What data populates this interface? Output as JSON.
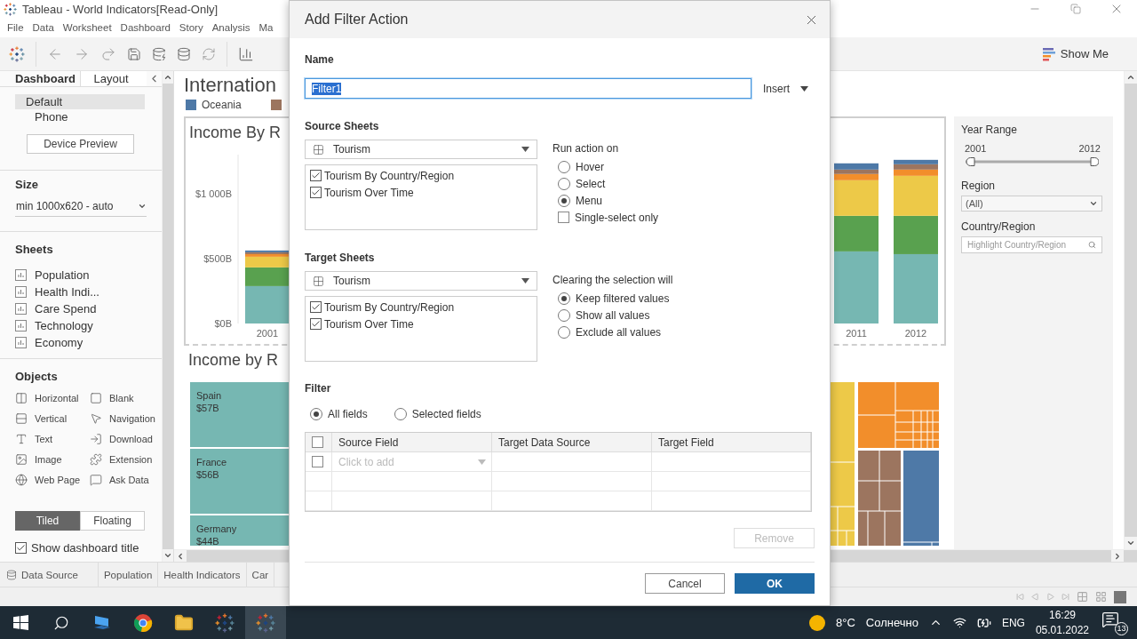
{
  "window": {
    "title": "Tableau - World Indicators[Read-Only]"
  },
  "menu": [
    "File",
    "Data",
    "Worksheet",
    "Dashboard",
    "Story",
    "Analysis",
    "Ma"
  ],
  "toolbar": {
    "show_me": "Show Me"
  },
  "left_panel": {
    "tabs": [
      {
        "label": "Dashboard",
        "selected": true
      },
      {
        "label": "Layout",
        "selected": false
      }
    ],
    "devices": [
      {
        "label": "Default",
        "selected": true,
        "children": [
          {
            "label": "Phone",
            "selected": false
          }
        ]
      }
    ],
    "device_preview": "Device Preview",
    "size": {
      "heading": "Size",
      "value": "min 1000x620 - auto"
    },
    "sheets": {
      "heading": "Sheets",
      "items": [
        "Population",
        "Health Indi...",
        "Care Spend",
        "Technology",
        "Economy"
      ]
    },
    "objects": {
      "heading": "Objects",
      "items": [
        {
          "kind": "horizontal",
          "label": "Horizontal"
        },
        {
          "kind": "blank",
          "label": "Blank"
        },
        {
          "kind": "vertical",
          "label": "Vertical"
        },
        {
          "kind": "navigation",
          "label": "Navigation"
        },
        {
          "kind": "text",
          "label": "Text"
        },
        {
          "kind": "download",
          "label": "Download"
        },
        {
          "kind": "image",
          "label": "Image"
        },
        {
          "kind": "extension",
          "label": "Extension"
        },
        {
          "kind": "webpage",
          "label": "Web Page"
        },
        {
          "kind": "askdata",
          "label": "Ask Data"
        }
      ]
    },
    "layout_mode": [
      {
        "label": "Tiled",
        "selected": true
      },
      {
        "label": "Floating",
        "selected": false
      }
    ],
    "show_title": {
      "label": "Show dashboard title",
      "checked": true
    }
  },
  "dashboard": {
    "title": "Internation",
    "bar_chart": {
      "title": "Income By R",
      "chart_data": {
        "type": "bar",
        "stacked": true,
        "categories": [
          "2001",
          "2011",
          "2012"
        ],
        "ylim": [
          0,
          1300
        ],
        "yticks": [
          {
            "value": 0,
            "label": "$0B"
          },
          {
            "value": 500,
            "label": "$500B"
          },
          {
            "value": 1000,
            "label": "$1 000B"
          }
        ],
        "series": [
          {
            "color": "#76b7b2",
            "values": [
              288,
              555,
              534
            ]
          },
          {
            "color": "#59a14f",
            "values": [
              144,
              274,
              295
            ]
          },
          {
            "color": "#edc948",
            "values": [
              82,
              274,
              308
            ]
          },
          {
            "color": "#f28e2b",
            "values": [
              20,
              48,
              48
            ]
          },
          {
            "color": "#9c755f",
            "values": [
              14,
              34,
              41
            ]
          },
          {
            "name": "Oceania",
            "color": "#4e79a7",
            "values": [
              14,
              48,
              34
            ]
          }
        ]
      }
    },
    "treemap": {
      "title": "Income by R",
      "tiles": [
        {
          "label": "Spain",
          "value": "$57B"
        },
        {
          "label": "France",
          "value": "$56B"
        },
        {
          "label": "Germany",
          "value": "$44B"
        }
      ]
    },
    "filters": {
      "year_range": {
        "label": "Year Range",
        "from": "2001",
        "to": "2012",
        "level": 1
      },
      "region": {
        "label": "Region",
        "value": "(All)"
      },
      "country": {
        "label": "Country/Region",
        "placeholder": "Highlight Country/Region"
      }
    }
  },
  "sheet_tabs": [
    {
      "label": "Data Source",
      "kind": "datasource"
    },
    {
      "label": "Population",
      "kind": "sheet"
    },
    {
      "label": "Health Indicators",
      "kind": "sheet"
    },
    {
      "label": "Car",
      "kind": "sheet"
    }
  ],
  "taskbar": {
    "temperature": "8°C",
    "weather": "Солнечно",
    "language": "ENG",
    "time": "16:29",
    "date": "05.01.2022",
    "notifications": "13"
  },
  "dialog": {
    "title": "Add Filter Action",
    "name_label": "Name",
    "name_value": "Filter1",
    "name_selected": true,
    "insert": "Insert",
    "source": {
      "heading": "Source Sheets",
      "dropdown": "Tourism",
      "sheets": [
        {
          "label": "Tourism By Country/Region",
          "checked": true
        },
        {
          "label": "Tourism Over Time",
          "checked": true
        }
      ]
    },
    "run_action": {
      "heading": "Run action on",
      "options": [
        {
          "label": "Hover",
          "selected": false
        },
        {
          "label": "Select",
          "selected": false
        },
        {
          "label": "Menu",
          "selected": true
        }
      ],
      "single_select": {
        "label": "Single-select only",
        "checked": false
      }
    },
    "target": {
      "heading": "Target Sheets",
      "dropdown": "Tourism",
      "sheets": [
        {
          "label": "Tourism By Country/Region",
          "checked": true
        },
        {
          "label": "Tourism Over Time",
          "checked": true
        }
      ]
    },
    "clearing": {
      "heading": "Clearing the selection will",
      "options": [
        {
          "label": "Keep filtered values",
          "selected": true
        },
        {
          "label": "Show all values",
          "selected": false
        },
        {
          "label": "Exclude all values",
          "selected": false
        }
      ]
    },
    "filter": {
      "heading": "Filter",
      "options": [
        {
          "label": "All fields",
          "selected": true
        },
        {
          "label": "Selected fields",
          "selected": false
        }
      ],
      "columns": [
        "Source Field",
        "Target Data Source",
        "Target Field"
      ],
      "header_checked": false,
      "rows": [
        {
          "checked": false,
          "placeholder": "Click to add"
        }
      ]
    },
    "remove": {
      "label": "Remove",
      "disabled": true
    },
    "cancel": "Cancel",
    "ok": "OK"
  }
}
